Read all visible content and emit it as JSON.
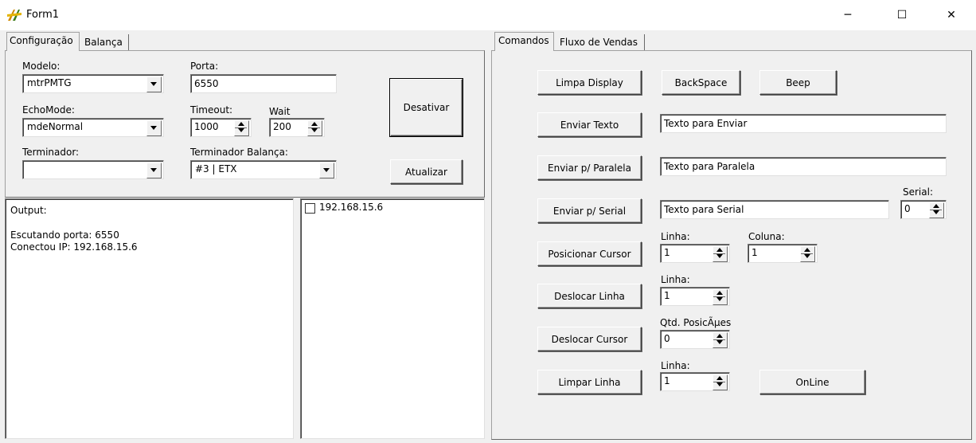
{
  "window": {
    "title": "Form1",
    "minimize_glyph": "─",
    "maximize_glyph": "☐",
    "close_glyph": "✕"
  },
  "left_tabs": [
    "Configuração",
    "Balança"
  ],
  "config": {
    "modelo_label": "Modelo:",
    "modelo_value": "mtrPMTG",
    "porta_label": "Porta:",
    "porta_value": "6550",
    "echomode_label": "EchoMode:",
    "echomode_value": "mdeNormal",
    "timeout_label": "Timeout:",
    "timeout_value": "1000",
    "wait_label": "Wait",
    "wait_value": "200",
    "terminador_label": "Terminador:",
    "terminador_value": "",
    "terminador_balanca_label": "Terminador Balança:",
    "terminador_balanca_value": "#3 | ETX",
    "desativar_label": "Desativar",
    "atualizar_label": "Atualizar"
  },
  "output": {
    "lines": [
      "Output:",
      "",
      "Escutando porta: 6550",
      "Conectou IP: 192.168.15.6"
    ]
  },
  "clients": [
    {
      "ip": "192.168.15.6",
      "checked": false
    }
  ],
  "right_tabs": [
    "Comandos",
    "Fluxo de Vendas"
  ],
  "comandos": {
    "limpa_display": "Limpa Display",
    "backspace": "BackSpace",
    "beep": "Beep",
    "enviar_texto": "Enviar Texto",
    "enviar_texto_value": "Texto para Enviar",
    "enviar_paralela": "Enviar p/ Paralela",
    "enviar_paralela_value": "Texto para Paralela",
    "enviar_serial": "Enviar p/ Serial",
    "enviar_serial_value": "Texto para Serial",
    "serial_label": "Serial:",
    "serial_value": "0",
    "posicionar_cursor": "Posicionar Cursor",
    "linha_label": "Linha:",
    "linha_value": "1",
    "coluna_label": "Coluna:",
    "coluna_value": "1",
    "deslocar_linha": "Deslocar Linha",
    "deslocar_linha_label": "Linha:",
    "deslocar_linha_value": "1",
    "deslocar_cursor": "Deslocar Cursor",
    "qtd_posicoes_label": "Qtd. PosicÃµes",
    "qtd_posicoes_value": "0",
    "limpar_linha": "Limpar Linha",
    "limpar_linha_label": "Linha:",
    "limpar_linha_value": "1",
    "online": "OnLine"
  }
}
